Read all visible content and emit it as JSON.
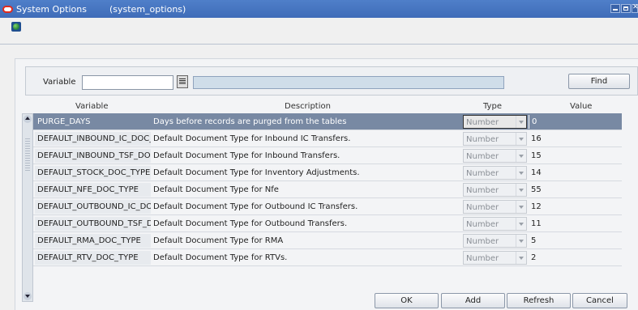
{
  "window": {
    "title": "System Options",
    "form_name": "(system_options)"
  },
  "search": {
    "variable_label": "Variable",
    "variable_value": "",
    "description_value": "",
    "find_label": "Find"
  },
  "table": {
    "headers": {
      "variable": "Variable",
      "description": "Description",
      "type": "Type",
      "value": "Value"
    },
    "rows": [
      {
        "variable": "PURGE_DAYS",
        "description": "Days before records are purged from the tables",
        "type": "Number",
        "value": "0",
        "selected": true
      },
      {
        "variable": "DEFAULT_INBOUND_IC_DOC_",
        "description": "Default Document Type for Inbound IC Transfers.",
        "type": "Number",
        "value": "16"
      },
      {
        "variable": "DEFAULT_INBOUND_TSF_DO(",
        "description": "Default Document Type for Inbound Transfers.",
        "type": "Number",
        "value": "15"
      },
      {
        "variable": "DEFAULT_STOCK_DOC_TYPE",
        "description": "Default Document Type for Inventory Adjustments.",
        "type": "Number",
        "value": "14"
      },
      {
        "variable": "DEFAULT_NFE_DOC_TYPE",
        "description": "Default Document Type for Nfe",
        "type": "Number",
        "value": "55"
      },
      {
        "variable": "DEFAULT_OUTBOUND_IC_DO",
        "description": "Default Document Type for Outbound IC Transfers.",
        "type": "Number",
        "value": "12"
      },
      {
        "variable": "DEFAULT_OUTBOUND_TSF_D",
        "description": "Default Document Type for Outbound Transfers.",
        "type": "Number",
        "value": "11"
      },
      {
        "variable": "DEFAULT_RMA_DOC_TYPE",
        "description": "Default Document Type for RMA",
        "type": "Number",
        "value": "5"
      },
      {
        "variable": "DEFAULT_RTV_DOC_TYPE",
        "description": "Default Document Type for RTVs.",
        "type": "Number",
        "value": "2"
      }
    ]
  },
  "buttons": {
    "ok": "OK",
    "add": "Add",
    "refresh": "Refresh",
    "cancel": "Cancel"
  }
}
